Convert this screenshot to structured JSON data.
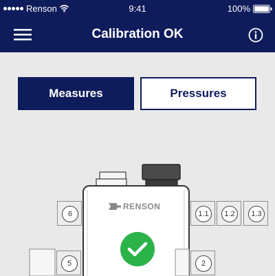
{
  "status_bar": {
    "carrier": "Renson",
    "time": "9:41",
    "battery": "100%"
  },
  "header": {
    "title": "Calibration OK",
    "menu_icon": "hamburger-menu-icon",
    "info_icon": "info-icon"
  },
  "tabs": [
    {
      "label": "Measures",
      "active": true
    },
    {
      "label": "Pressures",
      "active": false
    }
  ],
  "device": {
    "brand": "RENSON",
    "status_icon": "checkmark-icon",
    "status_color": "#2bb34a",
    "ports": [
      "6",
      "5",
      "1.1",
      "1.2",
      "1.3",
      "2"
    ]
  },
  "colors": {
    "primary": "#0f1c5c",
    "background": "#e9e9e9",
    "success": "#2bb34a"
  }
}
